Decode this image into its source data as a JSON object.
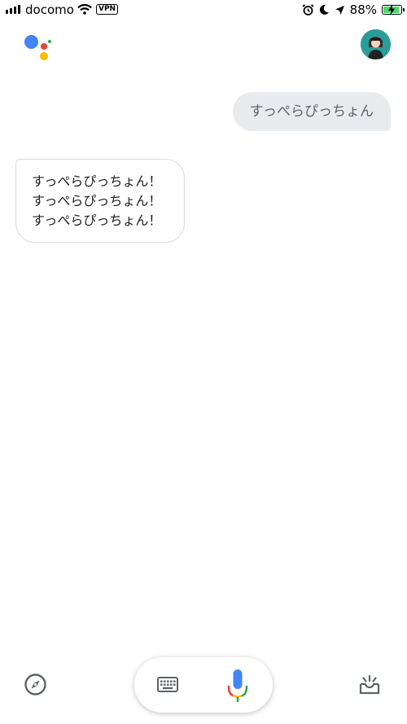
{
  "status_bar": {
    "carrier": "docomo",
    "vpn_label": "VPN",
    "battery_percent": "88%",
    "battery_level": 0.88,
    "icons": [
      "signal-icon",
      "wifi-icon",
      "alarm-icon",
      "moon-icon",
      "location-icon",
      "battery-charging-icon"
    ]
  },
  "header": {
    "logo": "google-assistant-logo",
    "colors": {
      "blue": "#4285F4",
      "red": "#EA4335",
      "yellow": "#FBBC05",
      "green": "#34A853"
    },
    "avatar": "user-avatar"
  },
  "conversation": {
    "user_message": "すっぺらぴっちょん",
    "assistant_lines": [
      "すっぺらぴっちょん！",
      "すっぺらぴっちょん！",
      "すっぺらぴっちょん！"
    ]
  },
  "bottom_bar": {
    "explore": "compass-icon",
    "keyboard": "keyboard-icon",
    "mic": "microphone-icon",
    "updates": "updates-tray-icon"
  }
}
